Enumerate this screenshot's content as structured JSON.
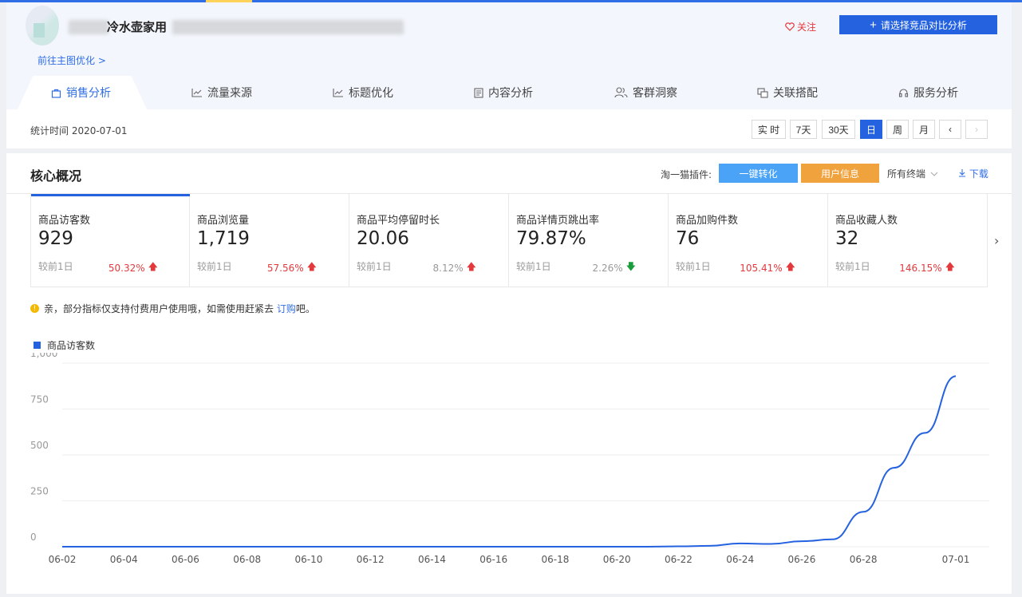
{
  "header": {
    "product_title": "冷水壶家用",
    "optimize_link": "前往主图优化 >",
    "follow_label": "关注",
    "compare_label": "请选择竞品对比分析"
  },
  "tabs": [
    {
      "label": "销售分析",
      "icon": "bag-icon",
      "active": true
    },
    {
      "label": "流量来源",
      "icon": "trend-icon",
      "active": false
    },
    {
      "label": "标题优化",
      "icon": "trend-icon",
      "active": false
    },
    {
      "label": "内容分析",
      "icon": "document-icon",
      "active": false
    },
    {
      "label": "客群洞察",
      "icon": "users-icon",
      "active": false
    },
    {
      "label": "关联搭配",
      "icon": "link-icon",
      "active": false
    },
    {
      "label": "服务分析",
      "icon": "headset-icon",
      "active": false
    }
  ],
  "subbar": {
    "stat_time": "统计时间 2020-07-01",
    "periods": [
      "实 时",
      "7天",
      "30天",
      "日",
      "周",
      "月"
    ],
    "active_period": "日"
  },
  "core": {
    "title": "核心概况",
    "plugin_label": "淘一猫插件:",
    "convert_label": "一键转化",
    "user_info_label": "用户信息",
    "terminal_label": "所有终端",
    "download_label": "下载"
  },
  "metrics": [
    {
      "label": "商品访客数",
      "value": "929",
      "prev": "较前1日",
      "change": "50.32%",
      "dir": "up"
    },
    {
      "label": "商品浏览量",
      "value": "1,719",
      "prev": "较前1日",
      "change": "57.56%",
      "dir": "up"
    },
    {
      "label": "商品平均停留时长",
      "value": "20.06",
      "prev": "较前1日",
      "change": "8.12%",
      "dir": "up"
    },
    {
      "label": "商品详情页跳出率",
      "value": "79.87%",
      "prev": "较前1日",
      "change": "2.26%",
      "dir": "down"
    },
    {
      "label": "商品加购件数",
      "value": "76",
      "prev": "较前1日",
      "change": "105.41%",
      "dir": "up"
    },
    {
      "label": "商品收藏人数",
      "value": "32",
      "prev": "较前1日",
      "change": "146.15%",
      "dir": "up"
    }
  ],
  "notice": {
    "text": "亲，部分指标仅支持付费用户使用哦，如需使用赶紧去",
    "link": "订购",
    "suffix": "吧。"
  },
  "colors": {
    "accent": "#2562e0",
    "up": "#e4393c",
    "down": "#1a9c3c",
    "convert": "#4aa3f7",
    "user_info": "#f0a23c"
  },
  "chart_data": {
    "type": "line",
    "legend": "商品访客数",
    "ylim": [
      0,
      1000
    ],
    "yticks": [
      "0",
      "250",
      "500",
      "750",
      "1,000"
    ],
    "xticks": [
      "06-02",
      "06-04",
      "06-06",
      "06-08",
      "06-10",
      "06-12",
      "06-14",
      "06-16",
      "06-18",
      "06-20",
      "06-22",
      "06-24",
      "06-26",
      "06-28",
      "07-01"
    ],
    "x": [
      "06-02",
      "06-03",
      "06-04",
      "06-05",
      "06-06",
      "06-07",
      "06-08",
      "06-09",
      "06-10",
      "06-11",
      "06-12",
      "06-13",
      "06-14",
      "06-15",
      "06-16",
      "06-17",
      "06-18",
      "06-19",
      "06-20",
      "06-21",
      "06-22",
      "06-23",
      "06-24",
      "06-25",
      "06-26",
      "06-27",
      "06-28",
      "06-29",
      "06-30",
      "07-01"
    ],
    "series": [
      {
        "name": "商品访客数",
        "values": [
          0,
          0,
          0,
          0,
          0,
          0,
          0,
          0,
          0,
          0,
          0,
          0,
          0,
          0,
          0,
          0,
          0,
          0,
          0,
          0,
          2,
          5,
          18,
          15,
          30,
          40,
          190,
          430,
          620,
          929
        ]
      }
    ]
  }
}
